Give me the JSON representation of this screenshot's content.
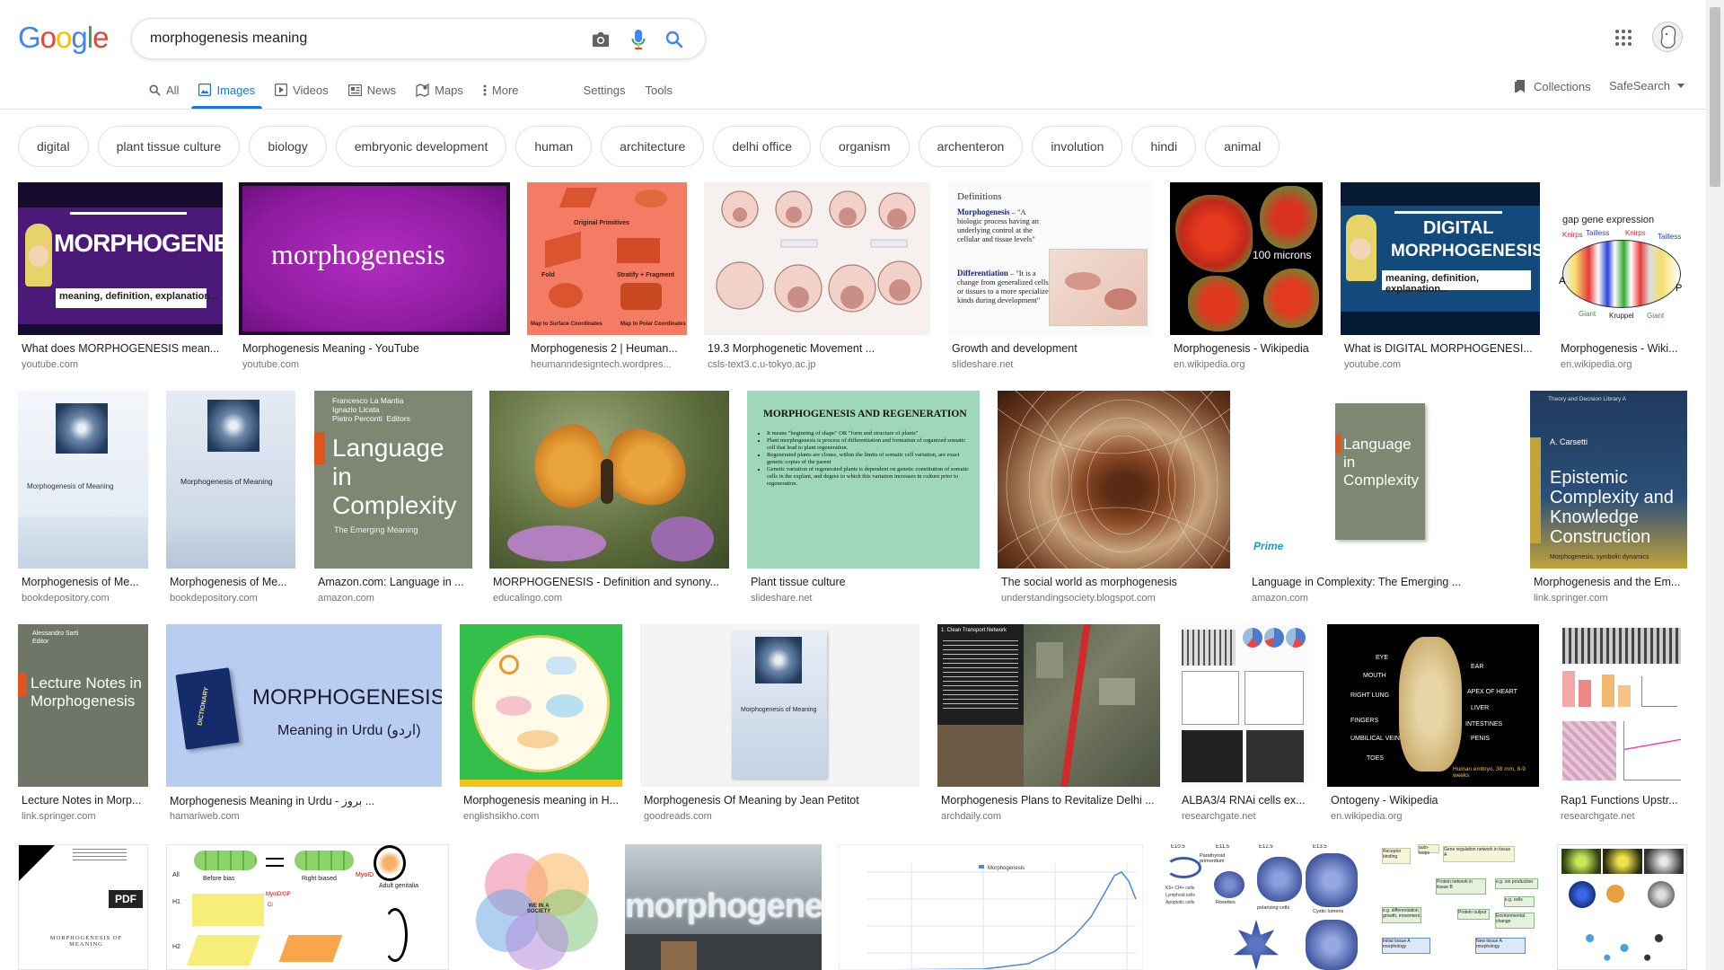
{
  "search": {
    "query": "morphogenesis meaning"
  },
  "logo": [
    "G",
    "o",
    "o",
    "g",
    "l",
    "e"
  ],
  "tabs": {
    "all": "All",
    "images": "Images",
    "videos": "Videos",
    "news": "News",
    "maps": "Maps",
    "more": "More",
    "settings": "Settings",
    "tools": "Tools"
  },
  "header_right": {
    "collections": "Collections",
    "safesearch": "SafeSearch"
  },
  "chips": [
    "digital",
    "plant tissue culture",
    "biology",
    "embryonic development",
    "human",
    "architecture",
    "delhi office",
    "organism",
    "archenteron",
    "involution",
    "hindi",
    "animal"
  ],
  "results": [
    {
      "title": "What does MORPHOGENESIS mean...",
      "source": "youtube.com",
      "art": {
        "main": "MORPHOGENESIS",
        "sub": "meaning, definition, explanation..."
      }
    },
    {
      "title": "Morphogenesis Meaning - YouTube",
      "source": "youtube.com",
      "art": {
        "main": "morphogenesis"
      }
    },
    {
      "title": "Morphogenesis 2 | Heuman...",
      "source": "heumanndesigntech.wordpres...",
      "art": {
        "labels": [
          "Original Primitives",
          "Fold",
          "Stratify + Fragment",
          "Map to Surface Coordinates",
          "Map to Polar Coordinates"
        ]
      }
    },
    {
      "title": "19.3 Morphogenetic Movement ...",
      "source": "csls-text3.c.u-tokyo.ac.jp",
      "art": {}
    },
    {
      "title": "Growth and development",
      "source": "slideshare.net",
      "art": {
        "heading": "Definitions",
        "term1": "Morphogenesis",
        "def1": "– \"A biologic process having an underlying control at the cellular and tissue levels\"",
        "term2": "Differentiation",
        "def2": "– \"It is a change from generalized cells or tissues to a more specialized kinds during development\""
      }
    },
    {
      "title": "Morphogenesis - Wikipedia",
      "source": "en.wikipedia.org",
      "art": {
        "scale": "100 microns"
      }
    },
    {
      "title": "What is DIGITAL MORPHOGENESI...",
      "source": "youtube.com",
      "art": {
        "main1": "DIGITAL",
        "main2": "MORPHOGENESIS",
        "sub": "meaning, definition, explanation..."
      }
    },
    {
      "title": "Morphogenesis - Wiki...",
      "source": "en.wikipedia.org",
      "art": {
        "heading": "gap gene expression",
        "genes": [
          "Knirps",
          "Tailless",
          "Knirps",
          "Tailless",
          "Giant",
          "Kruppel",
          "Giant"
        ],
        "a": "A",
        "p": "P"
      }
    },
    {
      "title": "Morphogenesis of Me...",
      "source": "bookdepository.com",
      "art": {
        "book": "Morphogenesis of Meaning"
      }
    },
    {
      "title": "Morphogenesis of Me...",
      "source": "bookdepository.com",
      "art": {
        "book": "Morphogenesis of Meaning"
      }
    },
    {
      "title": "Amazon.com: Language in ...",
      "source": "amazon.com",
      "art": {
        "authors": "Francesco La Mantia\nIgnazio Licata\nPietro Perconti  Editors",
        "main": "Language in Complexity",
        "sub": "The Emerging Meaning"
      }
    },
    {
      "title": "MORPHOGENESIS - Definition and synony...",
      "source": "educalingo.com",
      "art": {}
    },
    {
      "title": "Plant tissue culture",
      "source": "slideshare.net",
      "art": {
        "heading": "MORPHOGENESIS AND REGENERATION",
        "bullets": [
          "It means \"beginning of shape\" OR \"form and structure of plants\"",
          "Plant morphogenesis is process of differentiation and formation of organized somatic cell that lead to plant regeneration.",
          "Regenerated plants are clones, within the limits of somatic cell variation, are exact genetic copies of the parent",
          "Genetic variation of regenerated plants is dependent on genetic constitution of somatic cells in the explant, and degree to which this variation increases in culture prior to regeneration."
        ]
      }
    },
    {
      "title": "The social world as morphogenesis",
      "source": "understandingsociety.blogspot.com",
      "art": {}
    },
    {
      "title": "Language in Complexity: The Emerging ...",
      "source": "amazon.com",
      "art": {
        "main": "Language in Complexity",
        "badge": "Prime"
      }
    },
    {
      "title": "Morphogenesis and the Em...",
      "source": "link.springer.com",
      "art": {
        "series": "Theory and Decision Library A",
        "author": "A. Carsetti",
        "main": "Epistemic Complexity and Knowledge Construction",
        "sub": "Morphogenesis, symbolic dynamics"
      }
    },
    {
      "title": "Lecture Notes in Morp...",
      "source": "link.springer.com",
      "art": {
        "author": "Alessandro Sarti\nEditor",
        "main": "Lecture Notes in Morphogenesis"
      }
    },
    {
      "title": "Morphogenesis Meaning in Urdu - بروز ...",
      "source": "hamariweb.com",
      "art": {
        "book": "DICTIONARY",
        "main": "MORPHOGENESIS",
        "sub": "Meaning in Urdu (اردو)"
      }
    },
    {
      "title": "Morphogenesis meaning in H...",
      "source": "englishsikho.com",
      "art": {}
    },
    {
      "title": "Morphogenesis Of Meaning by Jean Petitot",
      "source": "goodreads.com",
      "art": {
        "book": "Morphogenesis of Meaning"
      }
    },
    {
      "title": "Morphogenesis Plans to Revitalize Delhi ...",
      "source": "archdaily.com",
      "art": {
        "heading": "1. Clean Transport Network"
      }
    },
    {
      "title": "ALBA3/4 RNAi cells ex...",
      "source": "researchgate.net",
      "art": {}
    },
    {
      "title": "Ontogeny - Wikipedia",
      "source": "en.wikipedia.org",
      "art": {
        "labels": [
          "EYE",
          "MOUTH",
          "EAR",
          "RIGHT LUNG",
          "APEX OF HEART",
          "LIVER",
          "FINGERS",
          "INTESTINES",
          "UMBILICAL VEIN",
          "PENIS",
          "TOES",
          "Human embryo, 38 mm, 8-9 weeks"
        ]
      }
    },
    {
      "title": "Rap1 Functions Upstr...",
      "source": "researchgate.net",
      "art": {}
    },
    {
      "art": {
        "pdf": "PDF",
        "book": "MORPHOGENESIS OF MEANING"
      }
    },
    {
      "art": {
        "labels": [
          "Before bias",
          "Right biased",
          "MyoID",
          "Adult genitalia",
          "All",
          "H1",
          "H2",
          "MyoID/GP",
          "Ci"
        ]
      }
    },
    {
      "art": {
        "center": "WE IN A SOCIETY"
      }
    },
    {
      "art": {
        "main": "morphogenesis"
      }
    },
    {
      "art": {
        "legend": "Morphogenesis"
      }
    },
    {
      "art": {
        "labels": [
          "E10.5",
          "E11.5",
          "E12.5",
          "E13.5",
          "Parathyroid primordium",
          "Rosettes",
          "polarizing cells",
          "Cystic lumens",
          "K5+ Cl4+ cells",
          "Lymphoid cells",
          "Apoptotic cells"
        ]
      }
    },
    {
      "art": {
        "labels": [
          "Receptor binding",
          "auto-loops",
          "Gene regulation network in tissue A",
          "Protein network in tissue B",
          "e.g. ion production",
          "e.g. cells",
          "e.g. differentiation, growth, movement",
          "Protein output",
          "Environmental change",
          "Initial tissue A morphology",
          "New tissue A morphology"
        ]
      }
    },
    {
      "art": {}
    }
  ]
}
